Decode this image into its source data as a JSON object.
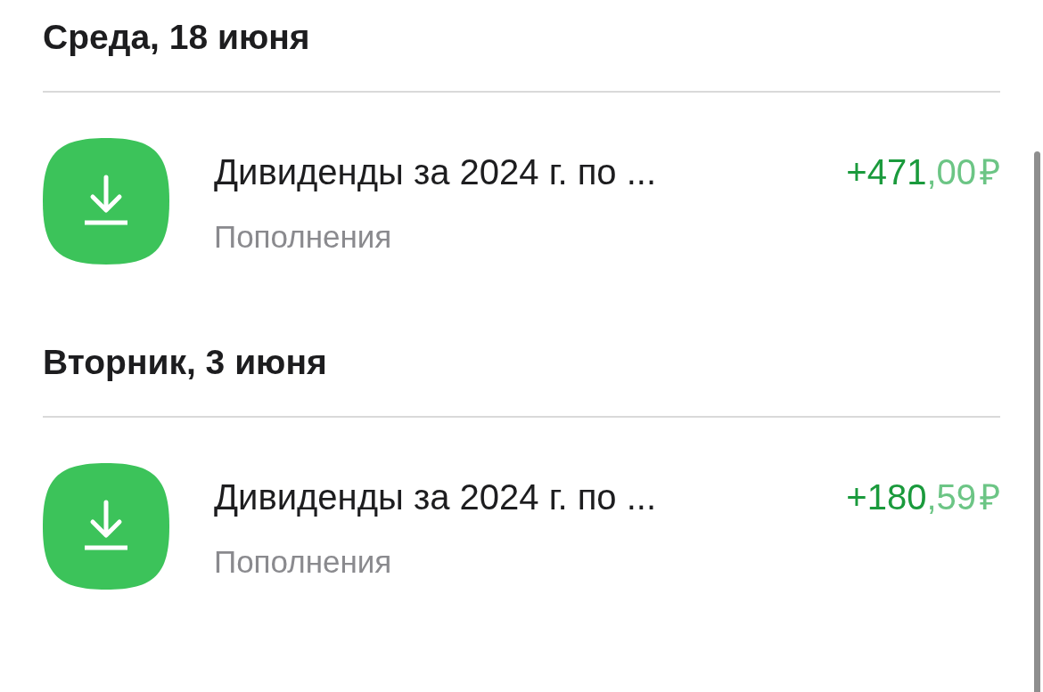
{
  "days": [
    {
      "date": "Среда, 18 июня",
      "operations": [
        {
          "title": "Дивиденды за 2024 г. по ...",
          "category": "Пополнения",
          "amount_whole": "+471",
          "amount_fraction": ",00",
          "currency": "₽"
        }
      ]
    },
    {
      "date": "Вторник, 3 июня",
      "operations": [
        {
          "title": "Дивиденды за 2024 г. по ...",
          "category": "Пополнения",
          "amount_whole": "+180",
          "amount_fraction": ",59",
          "currency": "₽"
        }
      ]
    }
  ]
}
